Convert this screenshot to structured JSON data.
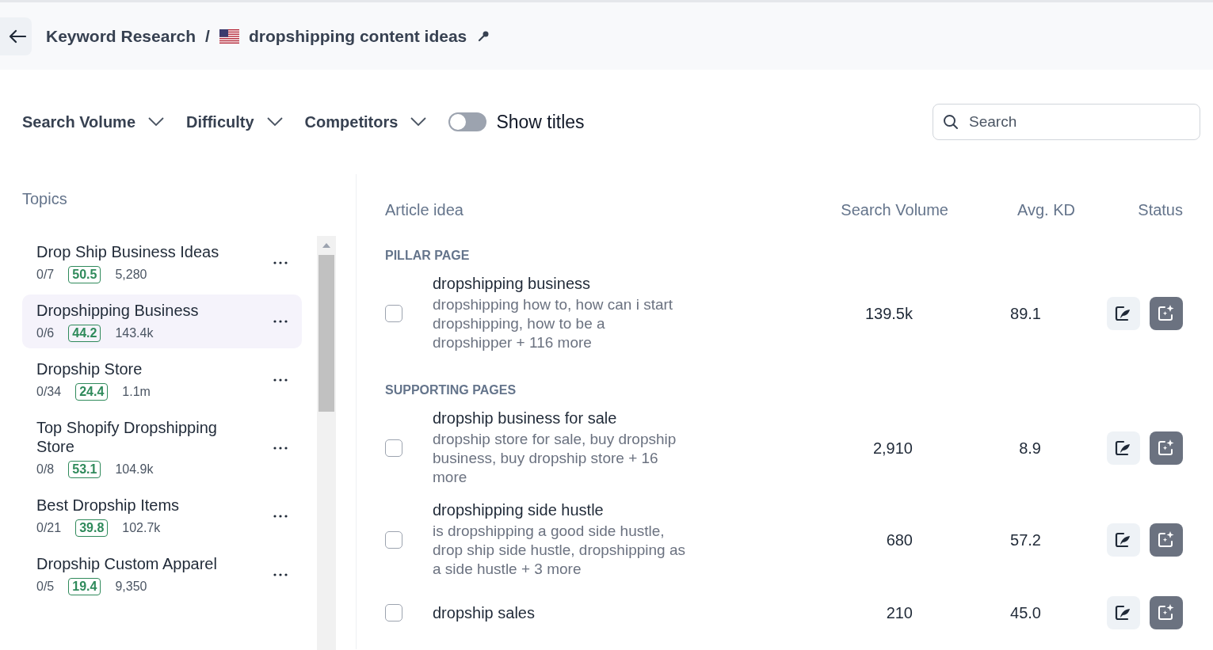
{
  "breadcrumb": {
    "parent": "Keyword Research",
    "separator": "/",
    "title": "dropshipping content ideas"
  },
  "filters": [
    {
      "label": "Search Volume"
    },
    {
      "label": "Difficulty"
    },
    {
      "label": "Competitors"
    }
  ],
  "show_titles": {
    "label": "Show titles",
    "on": false
  },
  "search": {
    "placeholder": "Search"
  },
  "topics": {
    "title": "Topics",
    "items": [
      {
        "name": "Drop Ship Business Ideas",
        "progress": "0/7",
        "kd": "50.5",
        "volume": "5,280",
        "selected": false
      },
      {
        "name": "Dropshipping Business",
        "progress": "0/6",
        "kd": "44.2",
        "volume": "143.4k",
        "selected": true
      },
      {
        "name": "Dropship Store",
        "progress": "0/34",
        "kd": "24.4",
        "volume": "1.1m",
        "selected": false
      },
      {
        "name": "Top Shopify Dropshipping Store",
        "progress": "0/8",
        "kd": "53.1",
        "volume": "104.9k",
        "selected": false
      },
      {
        "name": "Best Dropship Items",
        "progress": "0/21",
        "kd": "39.8",
        "volume": "102.7k",
        "selected": false
      },
      {
        "name": "Dropship Custom Apparel",
        "progress": "0/5",
        "kd": "19.4",
        "volume": "9,350",
        "selected": false
      }
    ]
  },
  "table": {
    "columns": [
      "Article idea",
      "Search Volume",
      "Avg. KD",
      "Status"
    ],
    "sections": [
      {
        "title": "PILLAR PAGE",
        "rows": [
          {
            "keyword": "dropshipping business",
            "related": "dropshipping how to, how can i start dropshipping, how to be a dropshipper + 116 more",
            "volume": "139.5k",
            "kd": "89.1",
            "checked": false
          }
        ]
      },
      {
        "title": "SUPPORTING PAGES",
        "rows": [
          {
            "keyword": "dropship business for sale",
            "related": "dropship store for sale, buy dropship business, buy dropship store + 16 more",
            "volume": "2,910",
            "kd": "8.9",
            "checked": false
          },
          {
            "keyword": "dropshipping side hustle",
            "related": "is dropshipping a good side hustle, drop ship side hustle, dropshipping as a side hustle + 3 more",
            "volume": "680",
            "kd": "57.2",
            "checked": false
          },
          {
            "keyword": "dropship sales",
            "volume": "210",
            "kd": "45.0",
            "checked": false
          }
        ]
      }
    ]
  }
}
